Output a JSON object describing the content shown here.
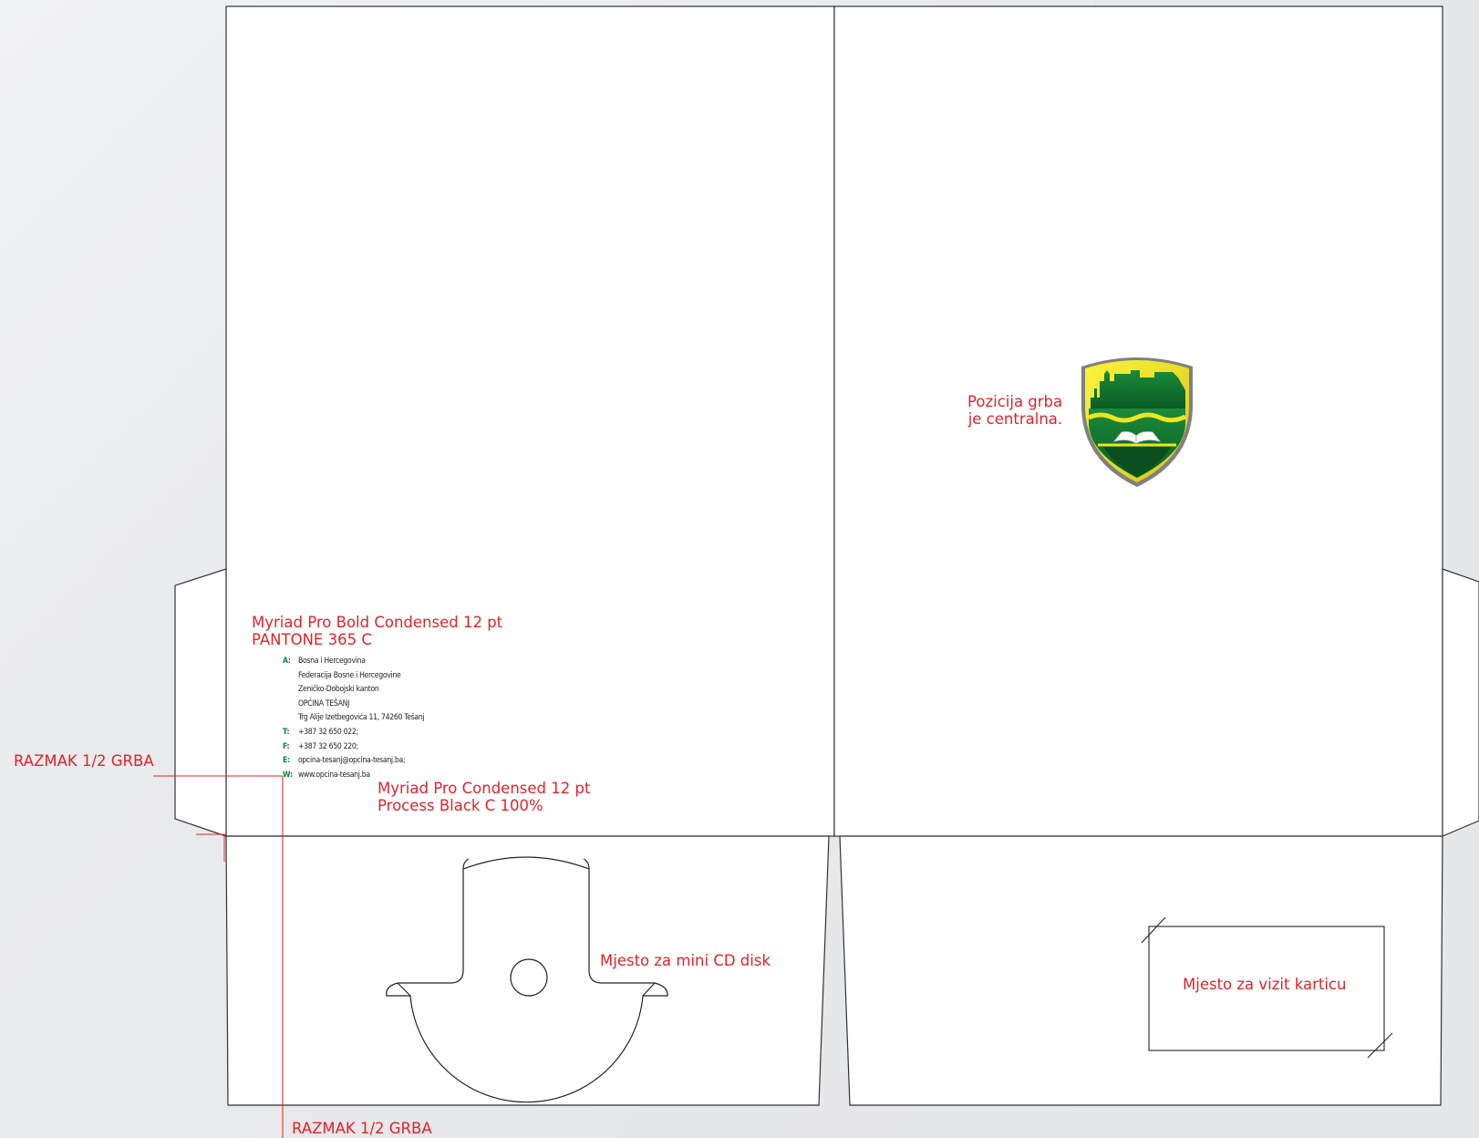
{
  "notes": {
    "font_spec_1_line1": "Myriad Pro Bold Condensed 12 pt",
    "font_spec_1_line2": "PANTONE 365 C",
    "font_spec_2_line1": "Myriad Pro Condensed 12 pt",
    "font_spec_2_line2": "Process Black C 100%",
    "crest_position_line1": "Pozicija grba",
    "crest_position_line2": "je centralna.",
    "spacing_left": "RAZMAK 1/2 GRBA",
    "spacing_bottom": "RAZMAK 1/2 GRBA",
    "cd_slot": "Mjesto za mini CD disk",
    "card_slot": "Mjesto za vizit karticu"
  },
  "contact": {
    "address_label": "A:",
    "address_lines": [
      "Bosna i Hercegovina",
      "Federacija Bosne i Hercegovine",
      "Zeničko-Dobojski kanton",
      "OPĆINA TEŠANJ",
      "Trg Alije Izetbegovića 11, 74260 Tešanj"
    ],
    "phone_label": "T:",
    "phone": "+387 32 650 022;",
    "fax_label": "F:",
    "fax": "+387 32 650 220;",
    "email_label": "E:",
    "email": "opcina-tesanj@opcina-tesanj.ba;",
    "web_label": "W:",
    "web": "www.opcina-tesanj.ba"
  },
  "colors": {
    "annotation_red": "#e2232a",
    "pantone_green": "#00873d",
    "crest_yellow": "#f0e12a",
    "crest_green": "#0b6e2c",
    "dieline": "#333333"
  },
  "icons": {
    "crest": "coat-of-arms-icon",
    "cd": "cd-disc-icon"
  }
}
